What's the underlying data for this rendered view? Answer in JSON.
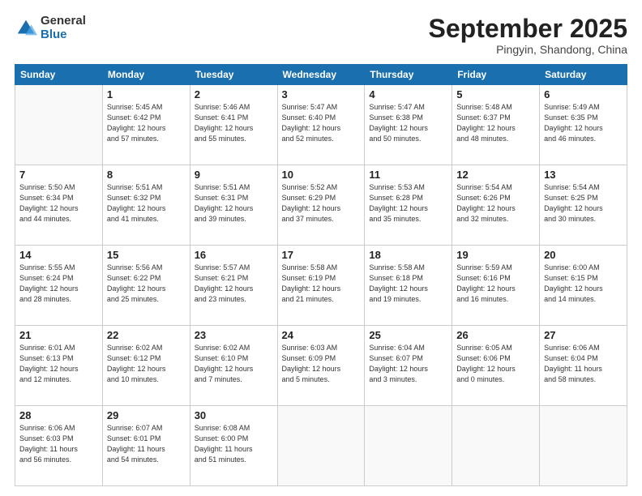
{
  "logo": {
    "general": "General",
    "blue": "Blue"
  },
  "header": {
    "month": "September 2025",
    "location": "Pingyin, Shandong, China"
  },
  "days_of_week": [
    "Sunday",
    "Monday",
    "Tuesday",
    "Wednesday",
    "Thursday",
    "Friday",
    "Saturday"
  ],
  "weeks": [
    [
      {
        "day": null,
        "info": null
      },
      {
        "day": "1",
        "info": "Sunrise: 5:45 AM\nSunset: 6:42 PM\nDaylight: 12 hours\nand 57 minutes."
      },
      {
        "day": "2",
        "info": "Sunrise: 5:46 AM\nSunset: 6:41 PM\nDaylight: 12 hours\nand 55 minutes."
      },
      {
        "day": "3",
        "info": "Sunrise: 5:47 AM\nSunset: 6:40 PM\nDaylight: 12 hours\nand 52 minutes."
      },
      {
        "day": "4",
        "info": "Sunrise: 5:47 AM\nSunset: 6:38 PM\nDaylight: 12 hours\nand 50 minutes."
      },
      {
        "day": "5",
        "info": "Sunrise: 5:48 AM\nSunset: 6:37 PM\nDaylight: 12 hours\nand 48 minutes."
      },
      {
        "day": "6",
        "info": "Sunrise: 5:49 AM\nSunset: 6:35 PM\nDaylight: 12 hours\nand 46 minutes."
      }
    ],
    [
      {
        "day": "7",
        "info": "Sunrise: 5:50 AM\nSunset: 6:34 PM\nDaylight: 12 hours\nand 44 minutes."
      },
      {
        "day": "8",
        "info": "Sunrise: 5:51 AM\nSunset: 6:32 PM\nDaylight: 12 hours\nand 41 minutes."
      },
      {
        "day": "9",
        "info": "Sunrise: 5:51 AM\nSunset: 6:31 PM\nDaylight: 12 hours\nand 39 minutes."
      },
      {
        "day": "10",
        "info": "Sunrise: 5:52 AM\nSunset: 6:29 PM\nDaylight: 12 hours\nand 37 minutes."
      },
      {
        "day": "11",
        "info": "Sunrise: 5:53 AM\nSunset: 6:28 PM\nDaylight: 12 hours\nand 35 minutes."
      },
      {
        "day": "12",
        "info": "Sunrise: 5:54 AM\nSunset: 6:26 PM\nDaylight: 12 hours\nand 32 minutes."
      },
      {
        "day": "13",
        "info": "Sunrise: 5:54 AM\nSunset: 6:25 PM\nDaylight: 12 hours\nand 30 minutes."
      }
    ],
    [
      {
        "day": "14",
        "info": "Sunrise: 5:55 AM\nSunset: 6:24 PM\nDaylight: 12 hours\nand 28 minutes."
      },
      {
        "day": "15",
        "info": "Sunrise: 5:56 AM\nSunset: 6:22 PM\nDaylight: 12 hours\nand 25 minutes."
      },
      {
        "day": "16",
        "info": "Sunrise: 5:57 AM\nSunset: 6:21 PM\nDaylight: 12 hours\nand 23 minutes."
      },
      {
        "day": "17",
        "info": "Sunrise: 5:58 AM\nSunset: 6:19 PM\nDaylight: 12 hours\nand 21 minutes."
      },
      {
        "day": "18",
        "info": "Sunrise: 5:58 AM\nSunset: 6:18 PM\nDaylight: 12 hours\nand 19 minutes."
      },
      {
        "day": "19",
        "info": "Sunrise: 5:59 AM\nSunset: 6:16 PM\nDaylight: 12 hours\nand 16 minutes."
      },
      {
        "day": "20",
        "info": "Sunrise: 6:00 AM\nSunset: 6:15 PM\nDaylight: 12 hours\nand 14 minutes."
      }
    ],
    [
      {
        "day": "21",
        "info": "Sunrise: 6:01 AM\nSunset: 6:13 PM\nDaylight: 12 hours\nand 12 minutes."
      },
      {
        "day": "22",
        "info": "Sunrise: 6:02 AM\nSunset: 6:12 PM\nDaylight: 12 hours\nand 10 minutes."
      },
      {
        "day": "23",
        "info": "Sunrise: 6:02 AM\nSunset: 6:10 PM\nDaylight: 12 hours\nand 7 minutes."
      },
      {
        "day": "24",
        "info": "Sunrise: 6:03 AM\nSunset: 6:09 PM\nDaylight: 12 hours\nand 5 minutes."
      },
      {
        "day": "25",
        "info": "Sunrise: 6:04 AM\nSunset: 6:07 PM\nDaylight: 12 hours\nand 3 minutes."
      },
      {
        "day": "26",
        "info": "Sunrise: 6:05 AM\nSunset: 6:06 PM\nDaylight: 12 hours\nand 0 minutes."
      },
      {
        "day": "27",
        "info": "Sunrise: 6:06 AM\nSunset: 6:04 PM\nDaylight: 11 hours\nand 58 minutes."
      }
    ],
    [
      {
        "day": "28",
        "info": "Sunrise: 6:06 AM\nSunset: 6:03 PM\nDaylight: 11 hours\nand 56 minutes."
      },
      {
        "day": "29",
        "info": "Sunrise: 6:07 AM\nSunset: 6:01 PM\nDaylight: 11 hours\nand 54 minutes."
      },
      {
        "day": "30",
        "info": "Sunrise: 6:08 AM\nSunset: 6:00 PM\nDaylight: 11 hours\nand 51 minutes."
      },
      {
        "day": null,
        "info": null
      },
      {
        "day": null,
        "info": null
      },
      {
        "day": null,
        "info": null
      },
      {
        "day": null,
        "info": null
      }
    ]
  ]
}
